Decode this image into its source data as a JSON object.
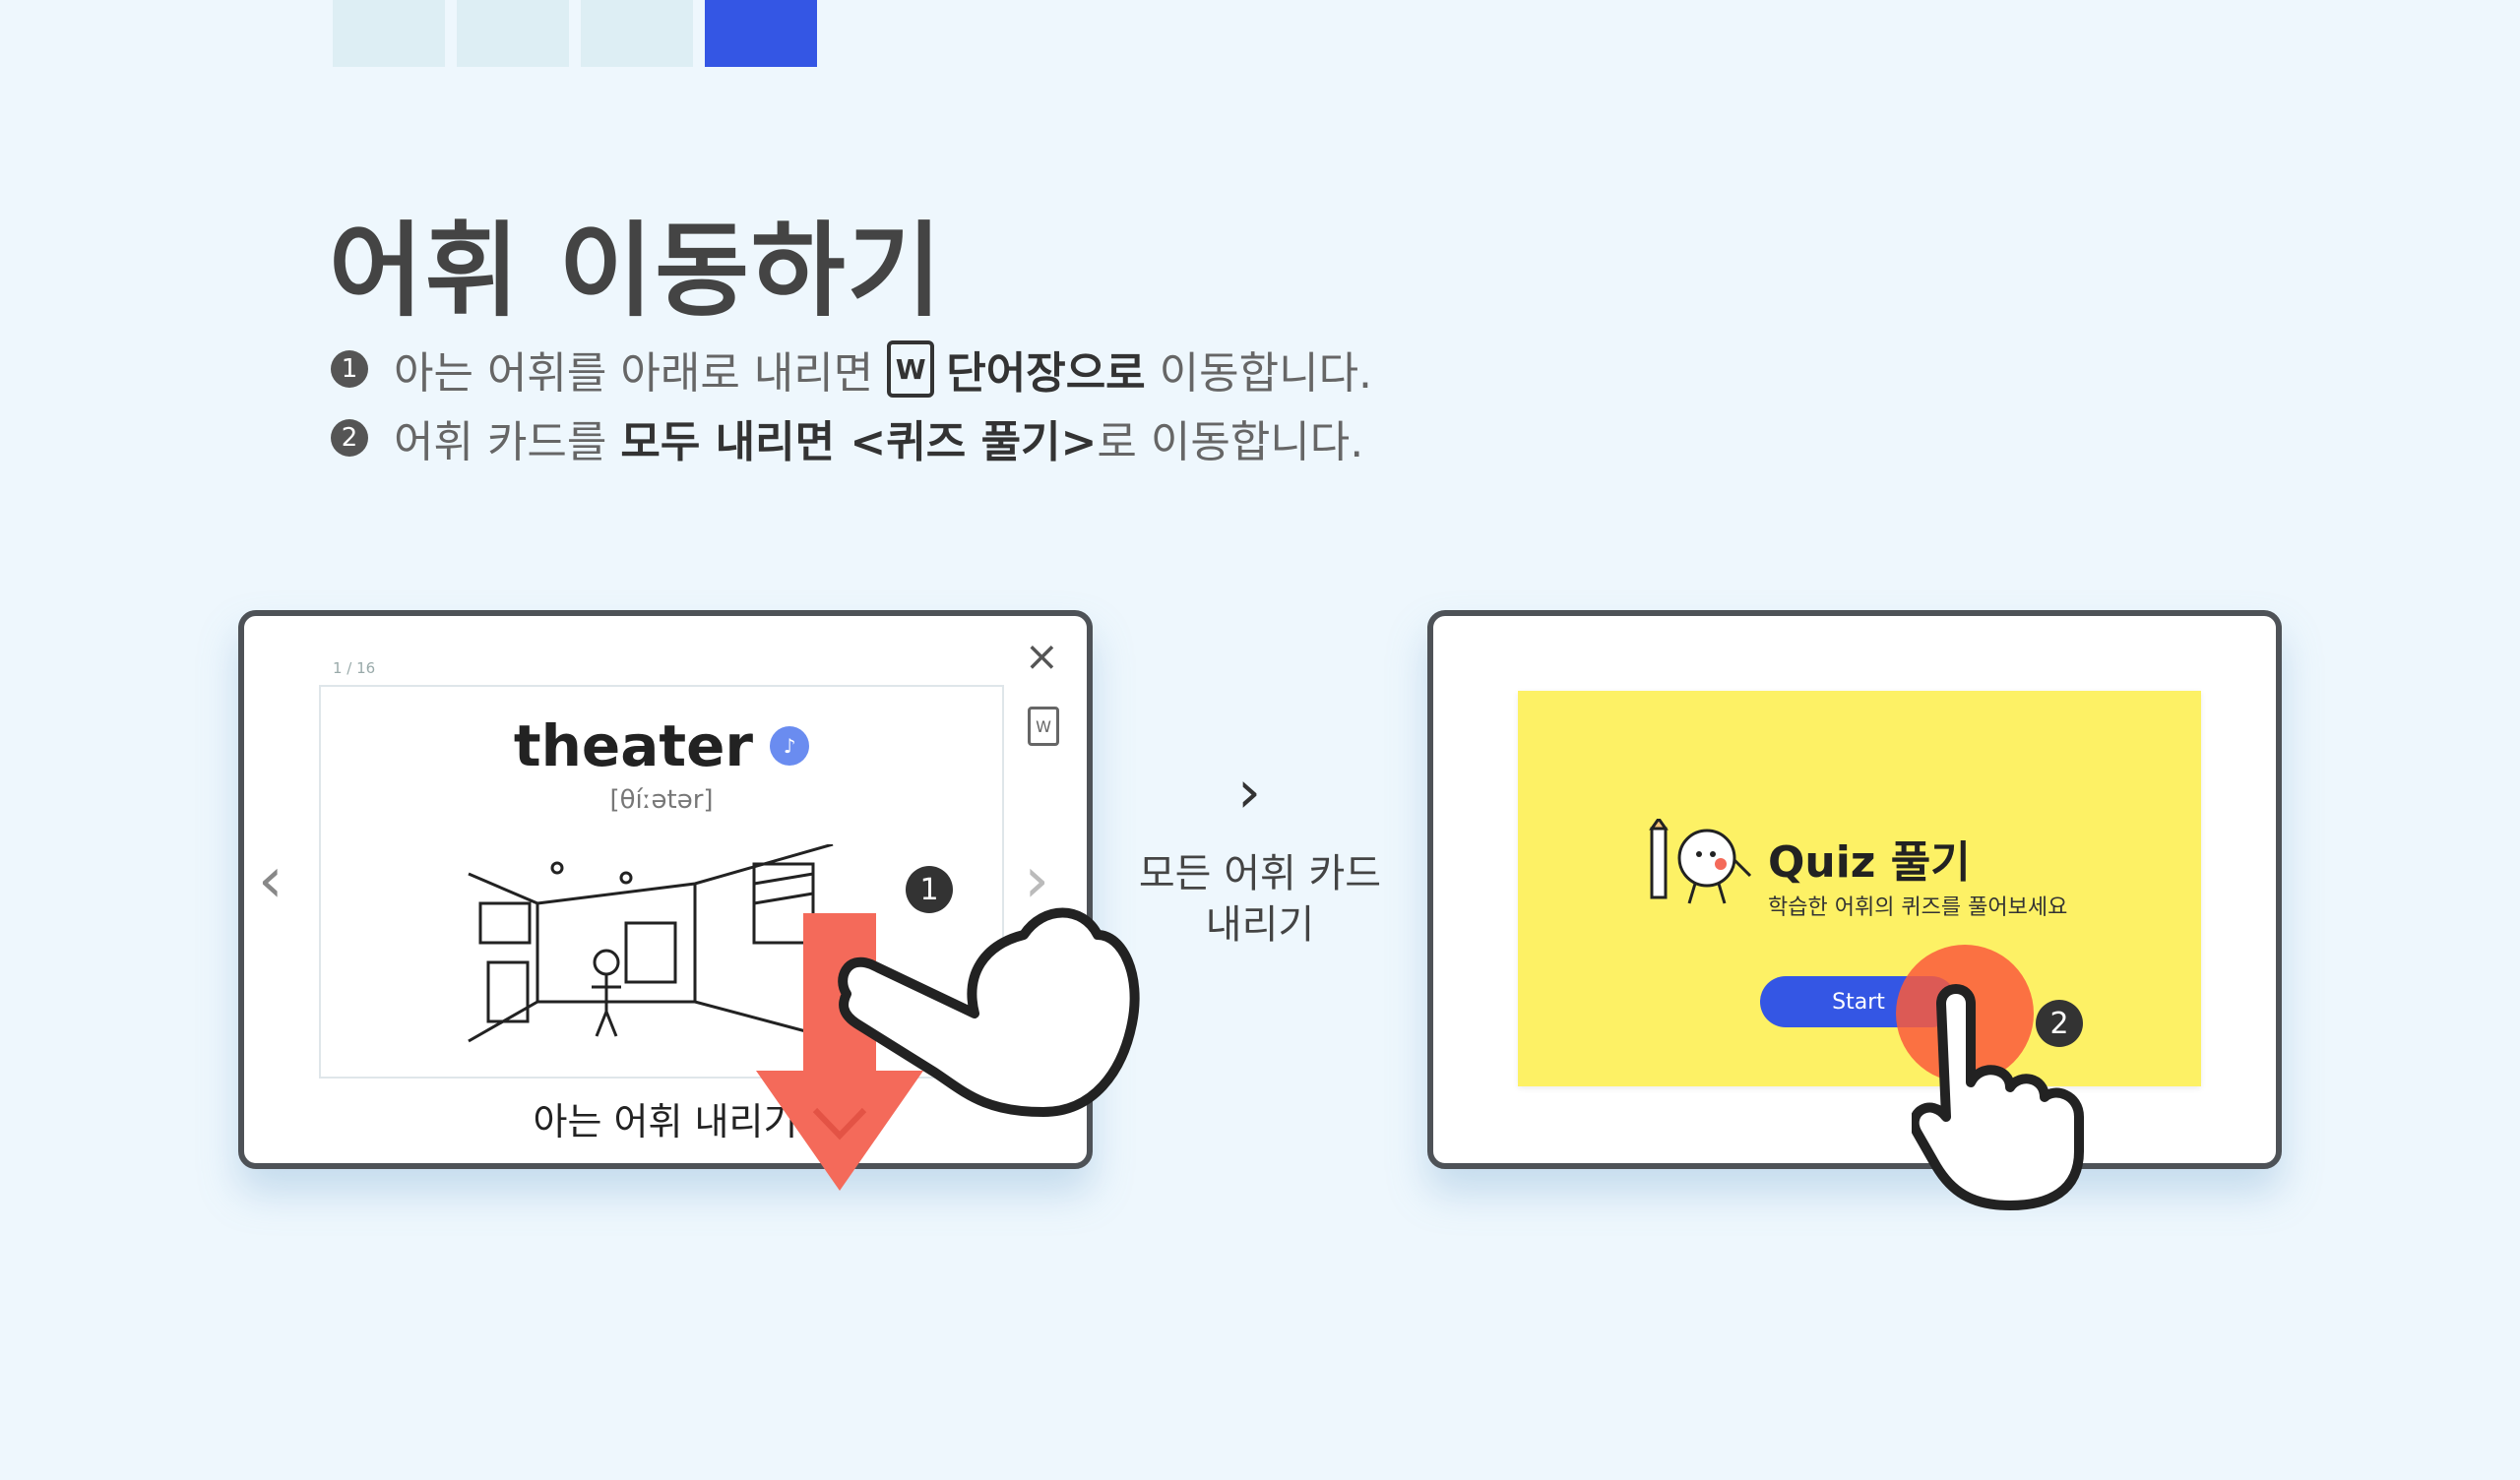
{
  "steps": {
    "active_index": 3
  },
  "title": "어휘 이동하기",
  "instructions": [
    {
      "num": "1",
      "text_a": "아는 어휘를 아래로 내리면",
      "icon": "W",
      "bold": "단어장으로",
      "text_b": "이동합니다."
    },
    {
      "num": "2",
      "text_a": "어휘 카드를",
      "bold": "모두 내리면 <퀴즈 풀기>",
      "text_b": "로 이동합니다."
    }
  ],
  "left_device": {
    "counter": "1 / 16",
    "close": "×",
    "wordbook_icon": "W",
    "word": "theater",
    "pronunciation": "[θíːətər]",
    "know_label": "아는 어휘 내리기",
    "badge": "1"
  },
  "middle": {
    "arrow": "›",
    "label_line1": "모든 어휘 카드",
    "label_line2": "내리기"
  },
  "right_device": {
    "quiz_title": "Quiz 풀기",
    "quiz_sub": "학습한 어휘의 퀴즈를 풀어보세요",
    "start_label": "Start",
    "badge": "2"
  },
  "colors": {
    "accent": "#3456e4",
    "quiz_bg": "#fdf165",
    "arrow": "#f46a5a",
    "bg": "#eef7fd"
  }
}
